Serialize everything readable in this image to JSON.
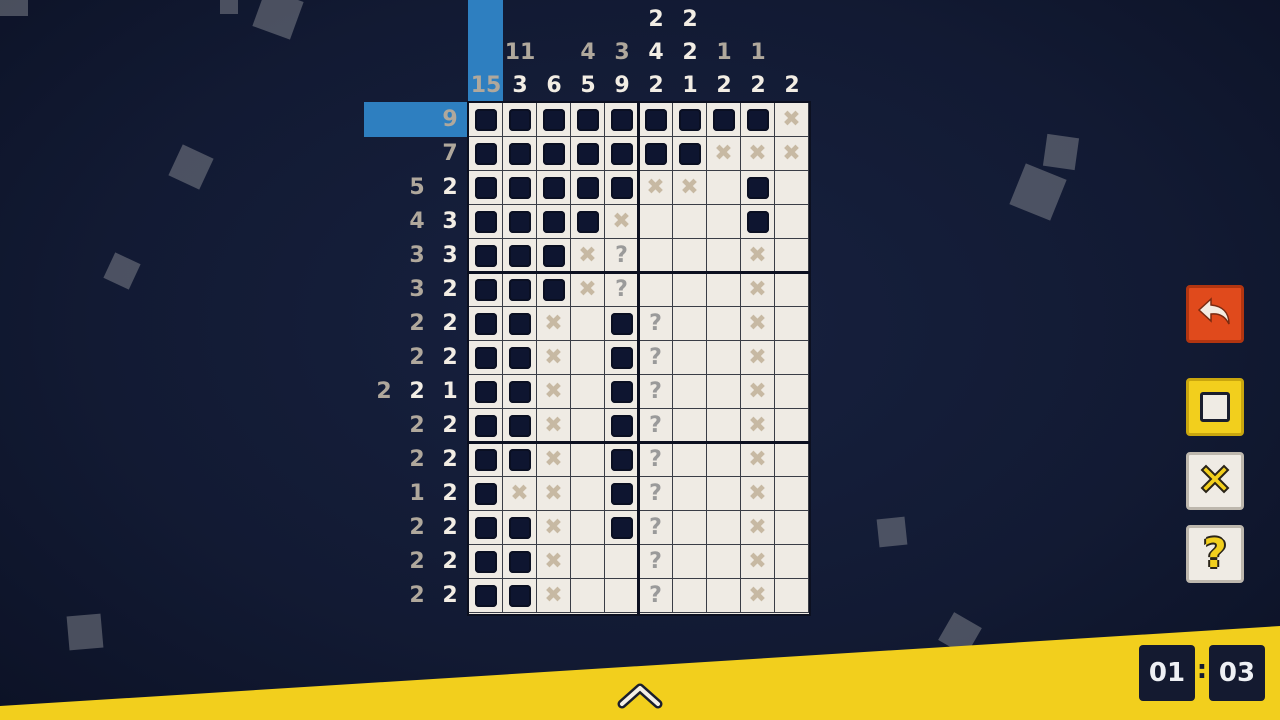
{
  "puzzle": {
    "selected_row_clue": "9",
    "selected_col_clue": "15",
    "column_clues": [
      [
        "15"
      ],
      [
        "11",
        "3"
      ],
      [
        "6"
      ],
      [
        "4",
        "5"
      ],
      [
        "3",
        "9"
      ],
      [
        "2",
        "4",
        "2"
      ],
      [
        "2",
        "2",
        "1"
      ],
      [
        "1",
        "2"
      ],
      [
        "1",
        "2"
      ],
      [
        "2"
      ]
    ],
    "column_clues_done": [
      [
        true
      ],
      [
        true,
        false
      ],
      [
        false
      ],
      [
        true,
        false
      ],
      [
        true,
        false
      ],
      [
        false,
        false,
        false
      ],
      [
        false,
        false,
        false
      ],
      [
        true,
        false
      ],
      [
        true,
        false
      ],
      [
        false
      ]
    ],
    "row_clues": [
      [
        "9"
      ],
      [
        "7"
      ],
      [
        "5",
        "2"
      ],
      [
        "4",
        "3"
      ],
      [
        "3",
        "3"
      ],
      [
        "3",
        "2"
      ],
      [
        "2",
        "2"
      ],
      [
        "2",
        "2"
      ],
      [
        "2",
        "2",
        "1"
      ],
      [
        "2",
        "2"
      ],
      [
        "2",
        "2"
      ],
      [
        "1",
        "2"
      ],
      [
        "2",
        "2"
      ],
      [
        "2",
        "2"
      ],
      [
        "2",
        "2"
      ]
    ],
    "row_clues_done": [
      [
        true
      ],
      [
        true
      ],
      [
        true,
        false
      ],
      [
        true,
        false
      ],
      [
        true,
        false
      ],
      [
        true,
        false
      ],
      [
        true,
        false
      ],
      [
        true,
        false
      ],
      [
        true,
        false,
        false
      ],
      [
        true,
        false
      ],
      [
        true,
        false
      ],
      [
        true,
        false
      ],
      [
        true,
        false
      ],
      [
        true,
        false
      ],
      [
        true,
        false
      ]
    ],
    "grid": [
      "#########x",
      "#######xxx",
      "#####xx.#.",
      "####x...#.",
      "###x?...x.",
      "###x?...x.",
      "##x.#?..x.",
      "##x.#?..x.",
      "##x.#?..x.",
      "##x.#?..x.",
      "##x.#?..x.",
      "#xx.#?..x.",
      "##x.#?..x.",
      "##x..?..x.",
      "##x..?..x."
    ]
  },
  "tools": {
    "undo_icon": "undo-arrow-icon",
    "fill_icon": "fill-square-icon",
    "cross_icon": "cross-mark-icon",
    "question_icon": "question-mark-icon",
    "question_glyph": "?"
  },
  "timer": {
    "minutes": "01",
    "seconds": "03",
    "separator": ":"
  },
  "bottom": {
    "expand_icon": "chevron-up-icon"
  },
  "colors": {
    "background": "#141c36",
    "highlight": "#2e7fc0",
    "board": "#efebe4",
    "filled": "#0e1530",
    "undo": "#e04a1c",
    "yellow": "#f2cf1d"
  }
}
